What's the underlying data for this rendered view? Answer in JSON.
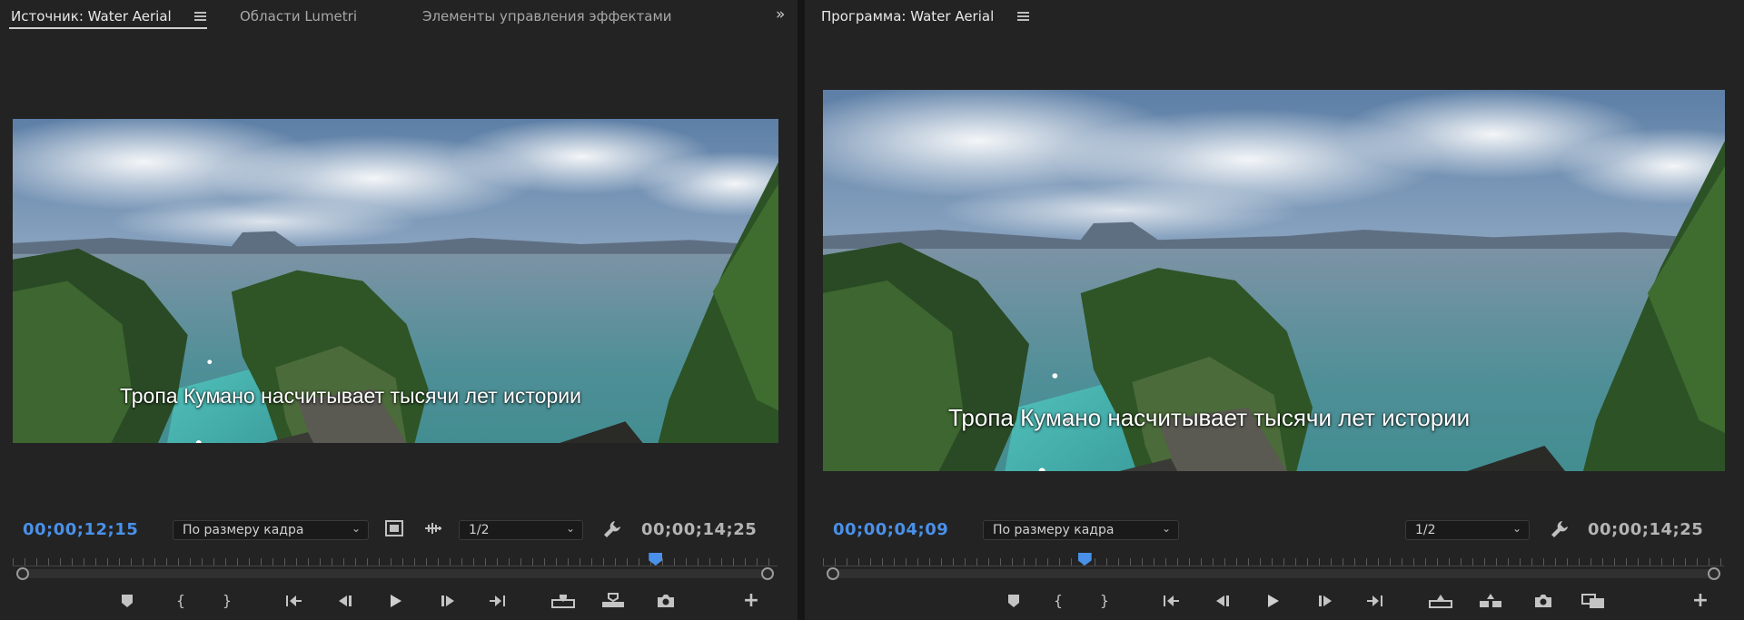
{
  "source_panel": {
    "tabs": [
      {
        "label": "Источник: Water Aerial",
        "active": true
      },
      {
        "label": "Области Lumetri",
        "active": false
      },
      {
        "label": "Элементы управления эффектами",
        "active": false
      }
    ],
    "caption": "Тропа Кумано насчитывает тысячи лет истории",
    "current_timecode": "00;00;12;15",
    "duration_timecode": "00;00;14;25",
    "zoom_dropdown": "По размеру кадра",
    "resolution_dropdown": "1/2",
    "playhead_fraction": 0.84
  },
  "program_panel": {
    "tab_label": "Программа: Water Aerial",
    "caption": "Тропа Кумано насчитывает тысячи лет истории",
    "current_timecode": "00;00;04;09",
    "duration_timecode": "00;00;14;25",
    "zoom_dropdown": "По размеру кадра",
    "resolution_dropdown": "1/2",
    "playhead_fraction": 0.29
  },
  "colors": {
    "accent_blue": "#4a90e8",
    "panel_bg": "#232323",
    "text_gray": "#b4b4b4"
  },
  "icons": {
    "source_controls": [
      "add-marker-icon",
      "mark-in-icon",
      "mark-out-icon",
      "go-to-in-icon",
      "step-back-icon",
      "play-icon",
      "step-forward-icon",
      "go-to-out-icon",
      "insert-icon",
      "overwrite-icon",
      "export-frame-icon",
      "button-editor-icon"
    ],
    "program_controls": [
      "add-marker-icon",
      "mark-in-icon",
      "mark-out-icon",
      "go-to-in-icon",
      "step-back-icon",
      "play-icon",
      "step-forward-icon",
      "go-to-out-icon",
      "lift-icon",
      "extract-icon",
      "export-frame-icon",
      "comparison-view-icon",
      "button-editor-icon"
    ]
  }
}
